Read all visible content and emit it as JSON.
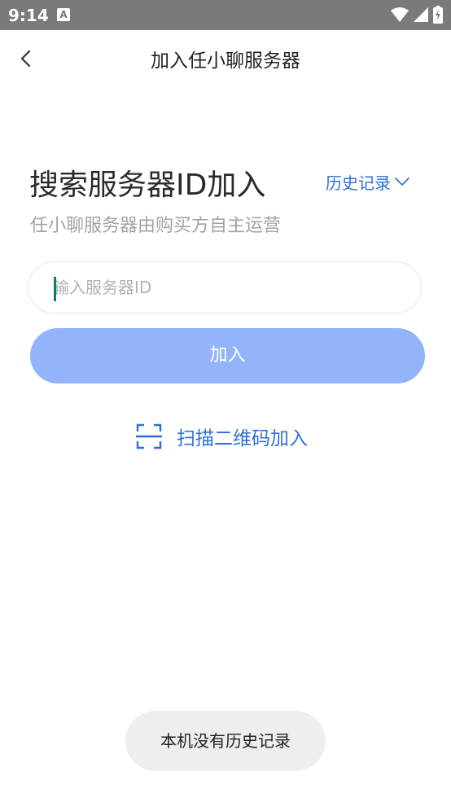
{
  "status_bar": {
    "time": "9:14",
    "app_icon_letter": "A"
  },
  "toolbar": {
    "title": "加入任小聊服务器"
  },
  "main": {
    "heading": "搜索服务器ID加入",
    "history_label": "历史记录",
    "subtitle": "任小聊服务器由购买方自主运营",
    "input_placeholder": "输入服务器ID",
    "join_button_label": "加入",
    "scan_label": "扫描二维码加入"
  },
  "toast": {
    "message": "本机没有历史记录"
  },
  "colors": {
    "status_bar_bg": "#7a7a7a",
    "accent_blue": "#2e6fd6",
    "join_button_bg": "#93b4fa",
    "caret": "#0e7a6e",
    "toast_bg": "#eeeeee"
  }
}
